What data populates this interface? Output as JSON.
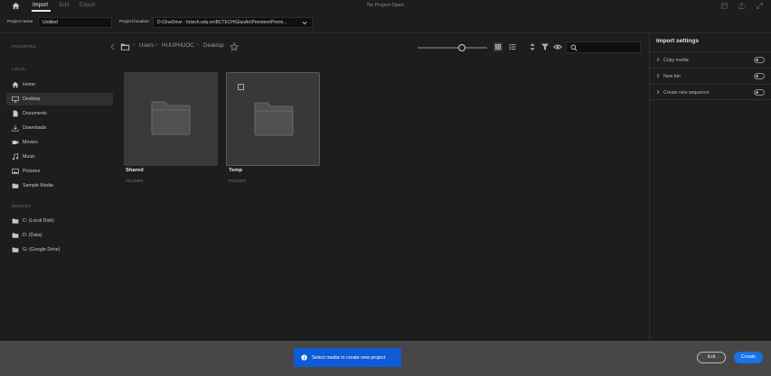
{
  "menu": {
    "tabs": [
      {
        "label": "Import",
        "active": true
      },
      {
        "label": "Edit",
        "active": false
      },
      {
        "label": "Export",
        "active": false
      }
    ],
    "title": "No Project Open"
  },
  "project_bar": {
    "name_label": "Project name",
    "name_value": "Untitled",
    "location_label": "Project location",
    "location_value": "D:\\OneDrive - bctech.edu.vn\\BCTECH\\GiaoAn\\Premiere\\Premi..."
  },
  "sidebar": {
    "favorites_heading": "FAVORITES",
    "local_heading": "LOCAL",
    "local_items": [
      {
        "label": "Home",
        "icon": "home-icon"
      },
      {
        "label": "Desktop",
        "icon": "monitor-icon",
        "selected": true
      },
      {
        "label": "Documents",
        "icon": "document-icon"
      },
      {
        "label": "Downloads",
        "icon": "download-icon"
      },
      {
        "label": "Movies",
        "icon": "camera-icon"
      },
      {
        "label": "Music",
        "icon": "music-note-icon"
      },
      {
        "label": "Pictures",
        "icon": "image-icon"
      },
      {
        "label": "Sample Media",
        "icon": "folder-icon"
      }
    ],
    "devices_heading": "DEVICES",
    "devices": [
      {
        "label": "C: (Local Disk)",
        "icon": "folder-icon"
      },
      {
        "label": "D: (Data)",
        "icon": "folder-icon"
      },
      {
        "label": "G: (Google Drive)",
        "icon": "folder-icon"
      }
    ]
  },
  "breadcrumb": [
    "Users",
    "HUUPHUOC",
    "Desktop"
  ],
  "browser": {
    "items": [
      {
        "name": "Shared",
        "type": "FOLDER"
      },
      {
        "name": "Temp",
        "type": "FOLDER"
      }
    ]
  },
  "import_settings": {
    "title": "Import settings",
    "options": [
      {
        "label": "Copy media",
        "enabled": false
      },
      {
        "label": "New bin",
        "enabled": false
      },
      {
        "label": "Create new sequence",
        "enabled": false
      }
    ]
  },
  "footer": {
    "toast": "Select media to create new project",
    "exit_label": "Exit",
    "create_label": "Create"
  },
  "colors": {
    "background": "#1d1d1d",
    "footer": "#474747",
    "accent_blue": "#1473e6",
    "toast_blue": "#0d5cd6"
  }
}
